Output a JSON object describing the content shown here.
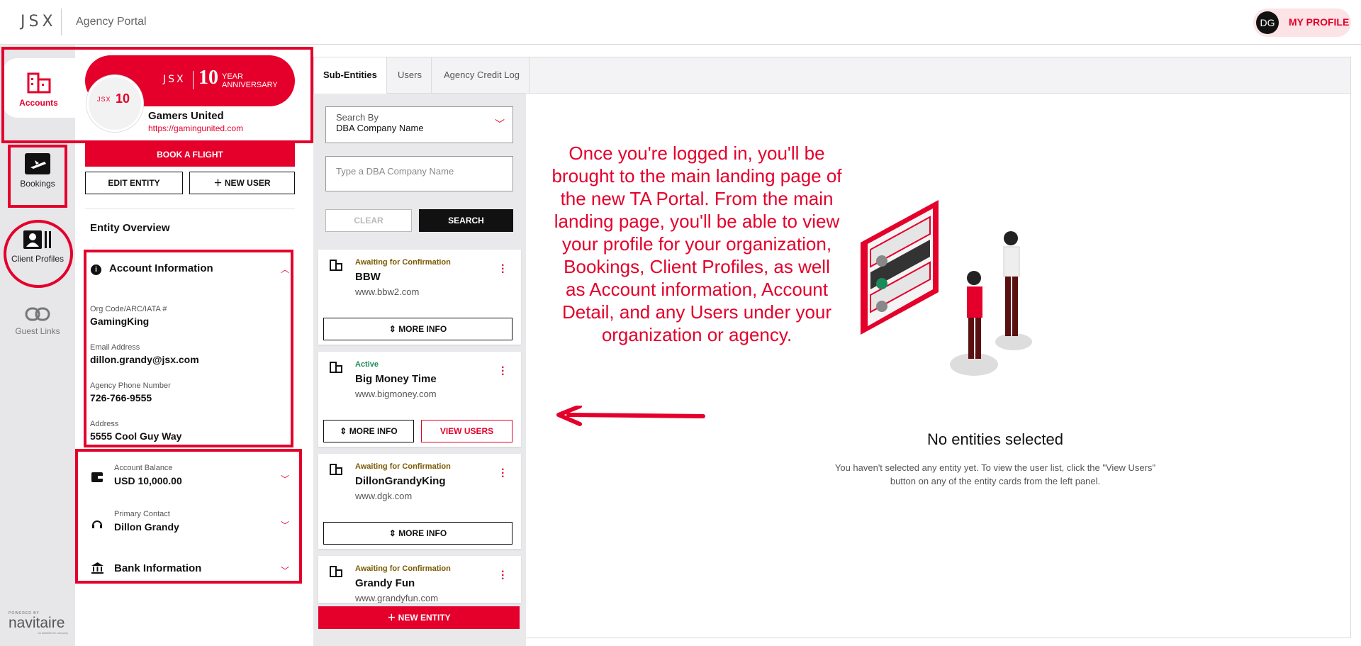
{
  "header": {
    "logo": "JSX",
    "app_title": "Agency Portal",
    "avatar_initials": "DG",
    "profile_label": "MY PROFILE"
  },
  "rail": {
    "items": [
      {
        "label": "Accounts",
        "icon": "accounts-icon",
        "active": true
      },
      {
        "label": "Bookings",
        "icon": "plane-icon"
      },
      {
        "label": "Client Profiles",
        "icon": "client-profiles-icon"
      },
      {
        "label": "Guest Links",
        "icon": "link-icon"
      }
    ],
    "powered_by": "POWERED BY",
    "brand": "navitaire",
    "brand_sub": "an AMADEUS company"
  },
  "account": {
    "banner_logo": "JSX",
    "banner_ten": "10",
    "banner_year": "YEAR",
    "banner_anniversary": "ANNIVERSARY",
    "badge_logo": "JSX",
    "badge_ten": "10",
    "org_name": "Gamers United",
    "org_url": "https://gamingunited.com",
    "book_flight": "BOOK A FLIGHT",
    "edit_entity": "EDIT ENTITY",
    "new_user": "NEW USER",
    "overview_title": "Entity Overview",
    "account_info_title": "Account Information",
    "fields": [
      {
        "label": "Org Code/ARC/IATA #",
        "value": "GamingKing"
      },
      {
        "label": "Email Address",
        "value": "dillon.grandy@jsx.com"
      },
      {
        "label": "Agency Phone Number",
        "value": "726-766-9555"
      },
      {
        "label": "Address",
        "value": "5555 Cool Guy Way"
      }
    ],
    "balance_label": "Account Balance",
    "balance_value": "USD 10,000.00",
    "contact_label": "Primary Contact",
    "contact_value": "Dillon Grandy",
    "bank_title": "Bank Information"
  },
  "tabs": [
    {
      "label": "Sub-Entities",
      "active": true
    },
    {
      "label": "Users"
    },
    {
      "label": "Agency Credit Log"
    }
  ],
  "entities": {
    "search_by_label": "Search By",
    "search_by_value": "DBA Company Name",
    "input_placeholder": "Type a DBA Company Name",
    "clear": "CLEAR",
    "search": "SEARCH",
    "cards": [
      {
        "status": "Awaiting for Confirmation",
        "name": "BBW",
        "url": "www.bbw2.com",
        "more": "MORE INFO"
      },
      {
        "status": "Active",
        "name": "Big Money Time",
        "url": "www.bigmoney.com",
        "more": "MORE INFO",
        "view": "VIEW USERS"
      },
      {
        "status": "Awaiting for Confirmation",
        "name": "DillonGrandyKing",
        "url": "www.dgk.com",
        "more": "MORE INFO"
      },
      {
        "status": "Awaiting for Confirmation",
        "name": "Grandy Fun",
        "url": "www.grandyfun.com"
      }
    ],
    "new_entity": "NEW ENTITY"
  },
  "main": {
    "annotation": "Once you're logged in, you'll be brought to the main landing page of the new TA Portal. From the main landing page, you'll be able to view your profile for your organization, Bookings, Client Profiles, as well as Account information, Account Detail, and any Users under your organization or agency.",
    "no_title": "No entities selected",
    "no_desc": "You haven't selected any entity yet. To view the user list, click the \"View Users\" button on any of the entity cards from the left panel."
  },
  "colors": {
    "accent": "#e4002b",
    "rail_bg": "#e7e7e9",
    "active_status": "#1a8a5a"
  }
}
